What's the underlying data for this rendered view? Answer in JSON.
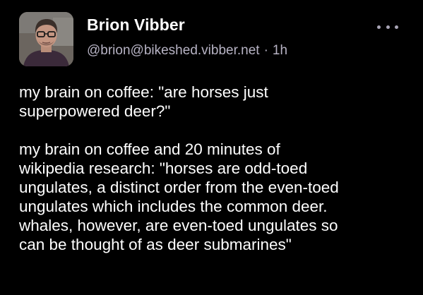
{
  "post": {
    "author": {
      "display_name": "Brion Vibber",
      "handle": "@brion@bikeshed.vibber.net",
      "avatar_icon": "profile-photo"
    },
    "separator": "·",
    "timestamp": "1h",
    "menu_icon": "more-options-icon",
    "paragraphs": [
      "my brain on coffee: \"are horses just\nsuperpowered deer?\"",
      "my brain on coffee and 20 minutes of\nwikipedia research: \"horses are odd-toed\nungulates, a distinct order from the even-toed\nungulates which includes the common deer.\nwhales, however, are even-toed ungulates so\ncan be thought of as deer submarines\""
    ]
  },
  "colors": {
    "background": "#000000",
    "text": "#ffffff",
    "secondary_text": "#b7b3c4"
  }
}
